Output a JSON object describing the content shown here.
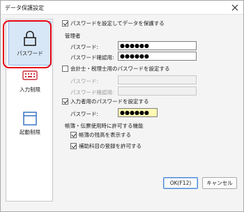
{
  "window": {
    "title": "データ保護設定"
  },
  "sidebar": {
    "items": [
      {
        "label": "パスワード",
        "icon": "lock-icon"
      },
      {
        "label": "入力制限",
        "icon": "keyboard-icon"
      },
      {
        "label": "起動制限",
        "icon": "window-icon"
      }
    ]
  },
  "main": {
    "protect_checkbox": {
      "label": "パスワードを設定してデータを保護する",
      "checked": true
    },
    "admin": {
      "heading": "管理者",
      "password_label": "パスワード:",
      "password_value": "●●●●●●",
      "confirm_label": "パスワード確認用:",
      "confirm_value": "●●●●●●"
    },
    "accountant_checkbox": {
      "label": "会計士・税理士用のパスワードを設定する",
      "checked": false
    },
    "accountant": {
      "password_label": "パスワード:",
      "confirm_label": "パスワード確認用:"
    },
    "input_user_checkbox": {
      "label": "入力者用のパスワードを設定する",
      "checked": true
    },
    "input_user": {
      "password_label": "パスワード:",
      "password_value": "●●●●●●"
    },
    "permissions": {
      "heading": "帳簿・伝票使用時に許可する機能",
      "show_balance": {
        "label": "帳簿の残高を表示する",
        "checked": true
      },
      "allow_sub_accounts": {
        "label": "補助科目の登録を許可する",
        "checked": true
      }
    }
  },
  "footer": {
    "ok_label": "OK(F12)",
    "cancel_label": "キャンセル"
  },
  "colors": {
    "selected_bg": "#d8e7f7",
    "highlight_ring": "#e60012",
    "nav_icon": "#c9303a",
    "yellow_field": "#fffbb4"
  }
}
